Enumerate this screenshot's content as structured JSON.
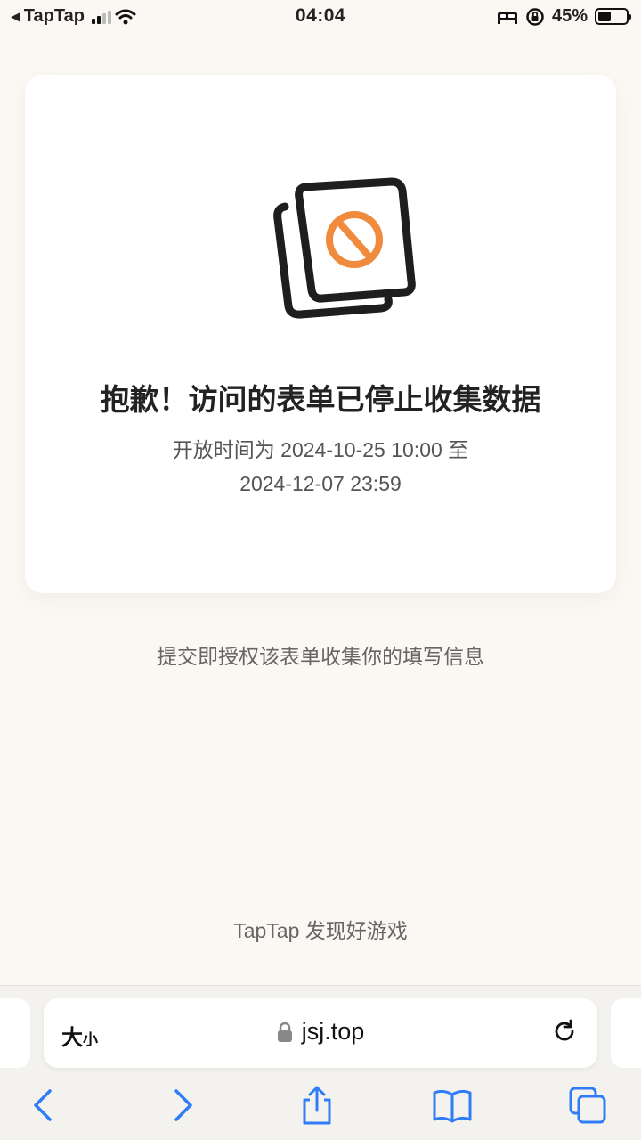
{
  "status_bar": {
    "back_app": "TapTap",
    "time": "04:04",
    "battery": "45%"
  },
  "card": {
    "title": "抱歉！访问的表单已停止收集数据",
    "subtitle_line1": "开放时间为 2024-10-25 10:00 至",
    "subtitle_line2": "2024-12-07 23:59",
    "icon": "form-disabled-icon"
  },
  "notice": "提交即授权该表单收集你的填写信息",
  "brand": "TapTap 发现好游戏",
  "browser": {
    "text_size_big": "大",
    "text_size_small": "小",
    "url": "jsj.top"
  },
  "colors": {
    "accent_orange": "#f08a3c",
    "toolbar_blue": "#2f7cf6",
    "background": "#fbf7f2"
  }
}
